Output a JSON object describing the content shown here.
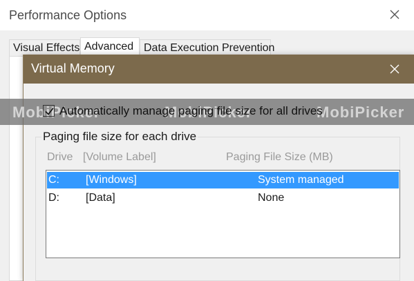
{
  "perf": {
    "title": "Performance Options",
    "tabs": [
      {
        "label": "Visual Effects"
      },
      {
        "label": "Advanced"
      },
      {
        "label": "Data Execution Prevention"
      }
    ]
  },
  "vm": {
    "title": "Virtual Memory",
    "auto_manage_label": "Automatically manage paging file size for all drives",
    "auto_manage_checked": true,
    "group_title": "Paging file size for each drive",
    "columns": {
      "drive": "Drive",
      "volume": "[Volume Label]",
      "size": "Paging File Size (MB)"
    },
    "drives": [
      {
        "drive": "C:",
        "label": "[Windows]",
        "size": "System managed",
        "selected": true
      },
      {
        "drive": "D:",
        "label": "[Data]",
        "size": "None",
        "selected": false
      }
    ]
  },
  "watermark": {
    "text": "MobiPicker"
  },
  "colors": {
    "titlebar": "#7c6a4c",
    "selection": "#3399ff"
  }
}
